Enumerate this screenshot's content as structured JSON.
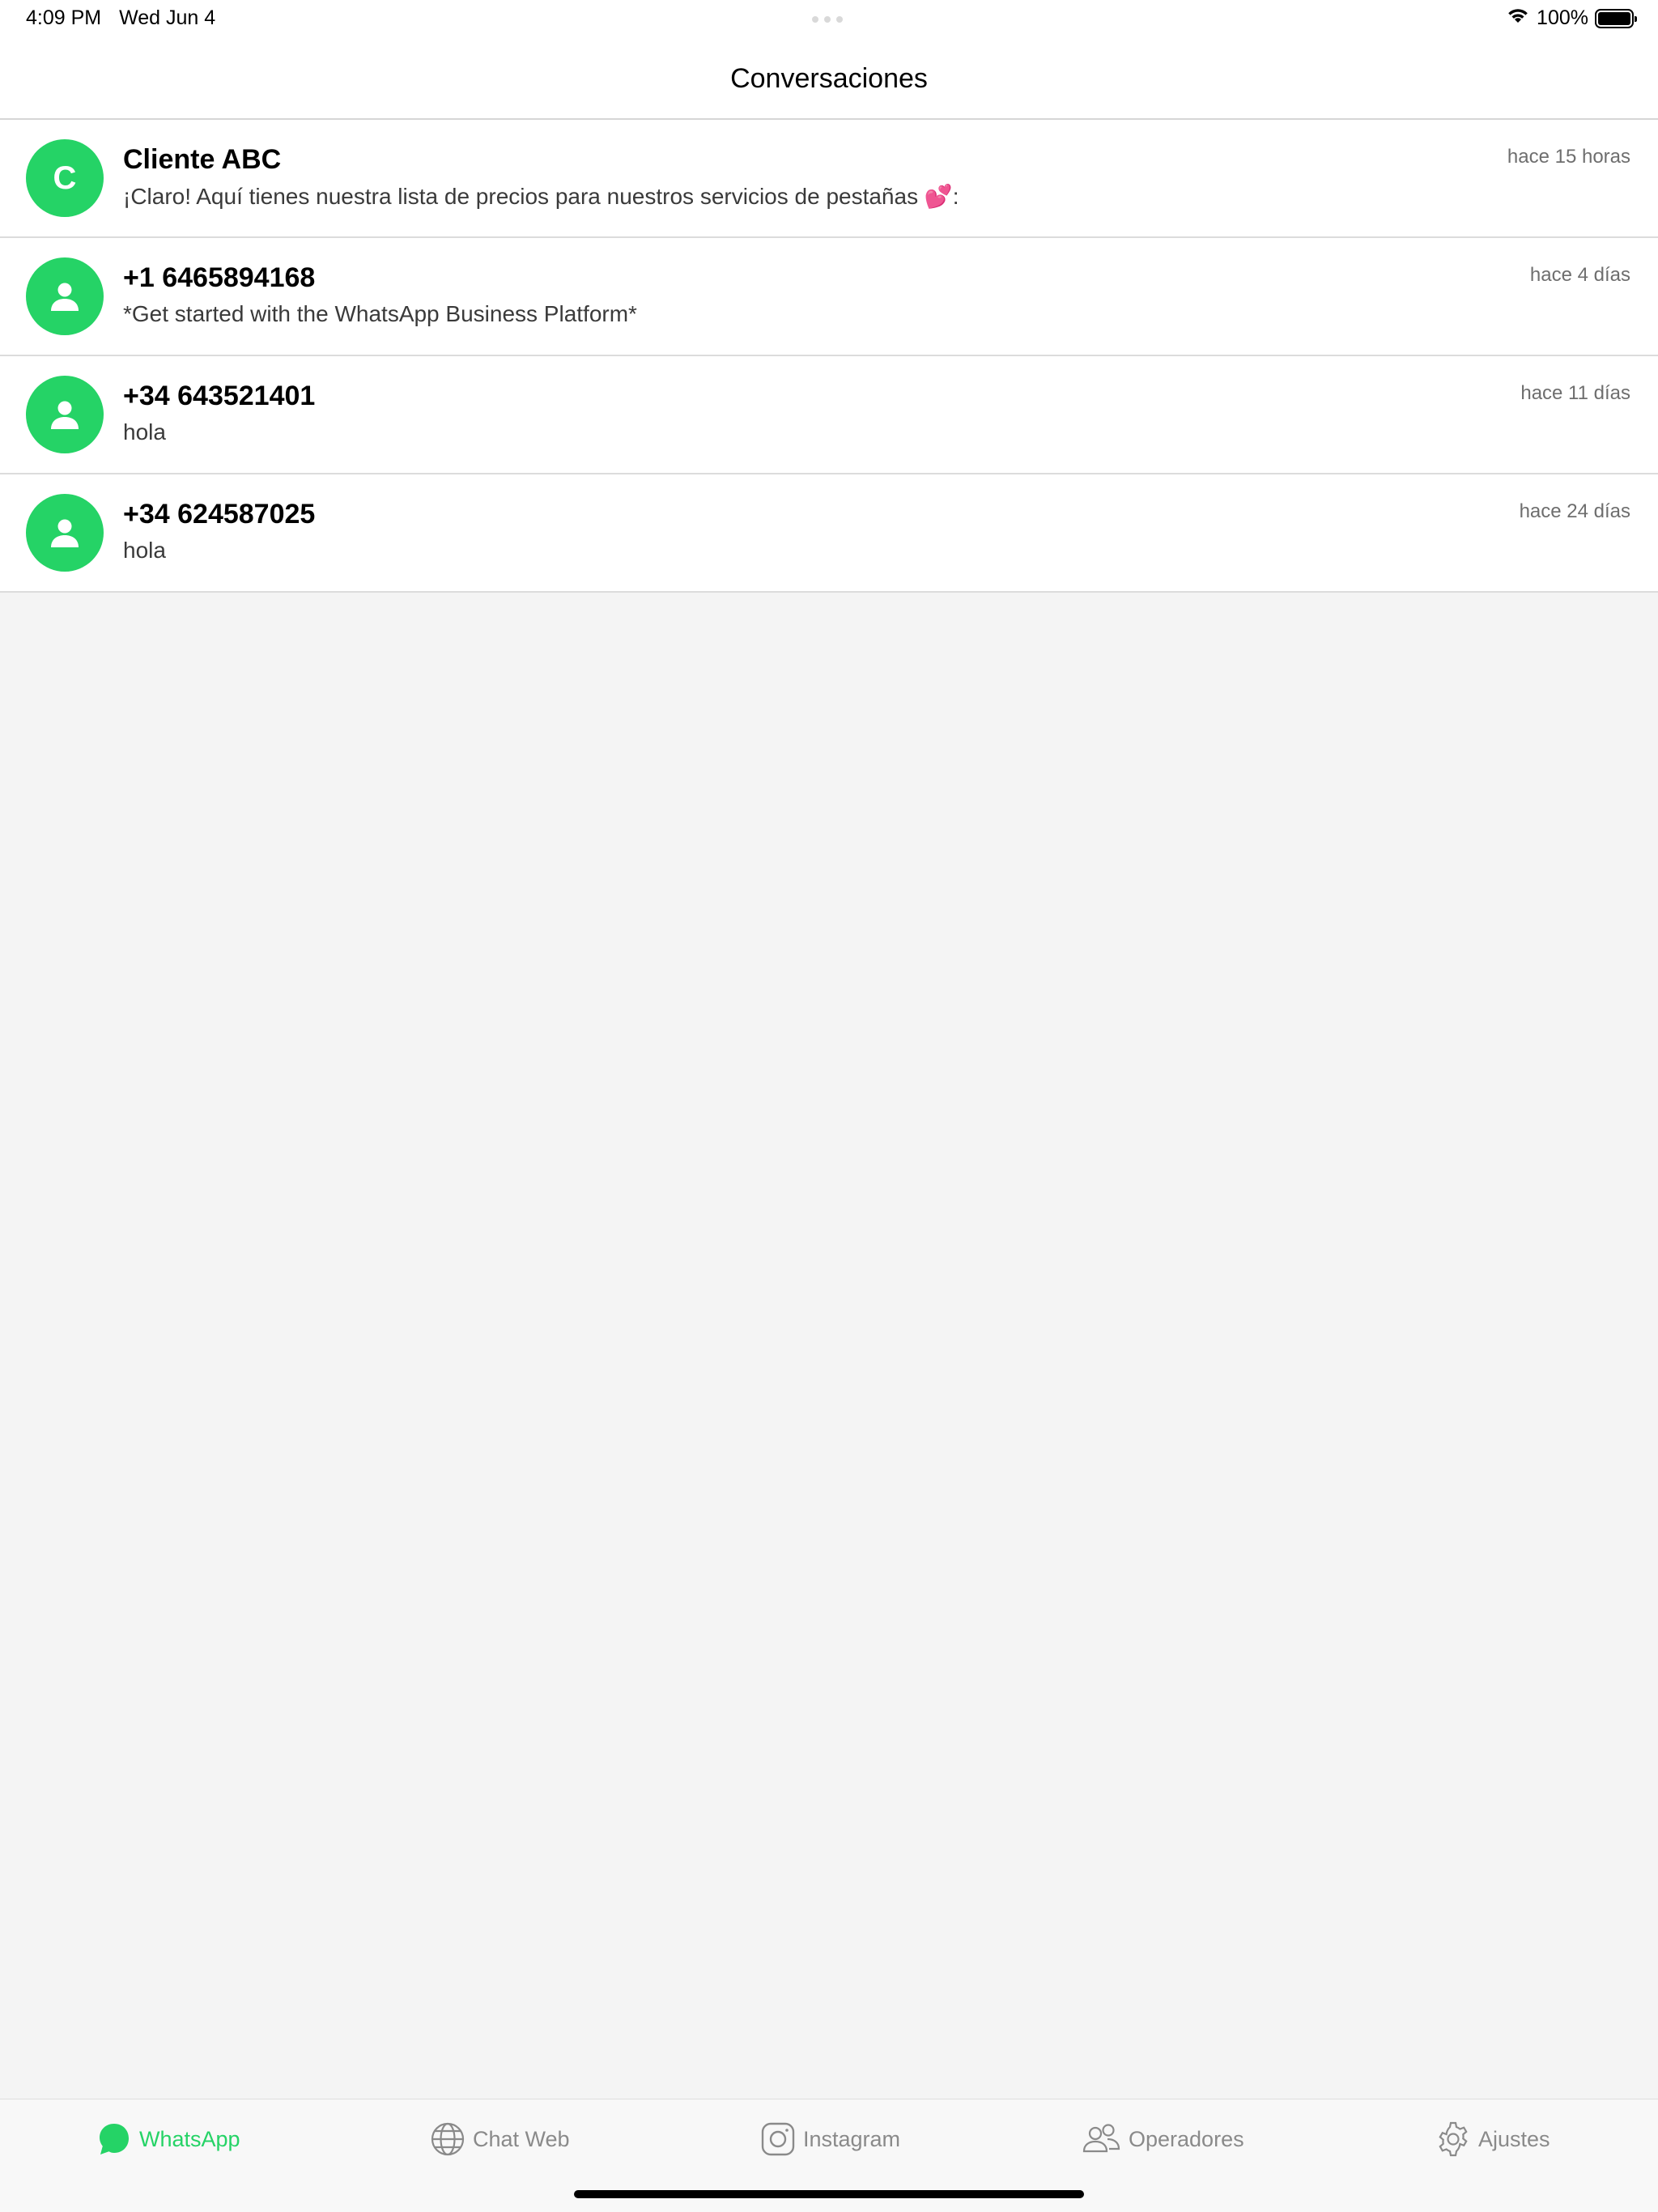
{
  "status_bar": {
    "time": "4:09 PM",
    "date": "Wed Jun 4",
    "battery": "100%"
  },
  "header": {
    "title": "Conversaciones"
  },
  "conversations": [
    {
      "avatar_letter": "C",
      "name": "Cliente ABC",
      "preview": "¡Claro! Aquí tienes nuestra lista de precios para nuestros servicios de pestañas 💕:",
      "time": "hace 15 horas"
    },
    {
      "avatar_icon": "person-icon",
      "name": "+1 6465894168",
      "preview": "*Get started with the WhatsApp Business Platform*",
      "time": "hace 4 días"
    },
    {
      "avatar_icon": "person-icon",
      "name": "+34 643521401",
      "preview": "hola",
      "time": "hace 11 días"
    },
    {
      "avatar_icon": "person-icon",
      "name": "+34 624587025",
      "preview": "hola",
      "time": "hace 24 días"
    }
  ],
  "tabs": [
    {
      "label": "WhatsApp",
      "icon": "whatsapp-icon",
      "active": true
    },
    {
      "label": "Chat Web",
      "icon": "globe-icon",
      "active": false
    },
    {
      "label": "Instagram",
      "icon": "instagram-icon",
      "active": false
    },
    {
      "label": "Operadores",
      "icon": "users-icon",
      "active": false
    },
    {
      "label": "Ajustes",
      "icon": "gear-icon",
      "active": false
    }
  ],
  "colors": {
    "accent": "#25d366",
    "inactive_tab": "#8a8a8a",
    "background": "#f4f4f4"
  }
}
